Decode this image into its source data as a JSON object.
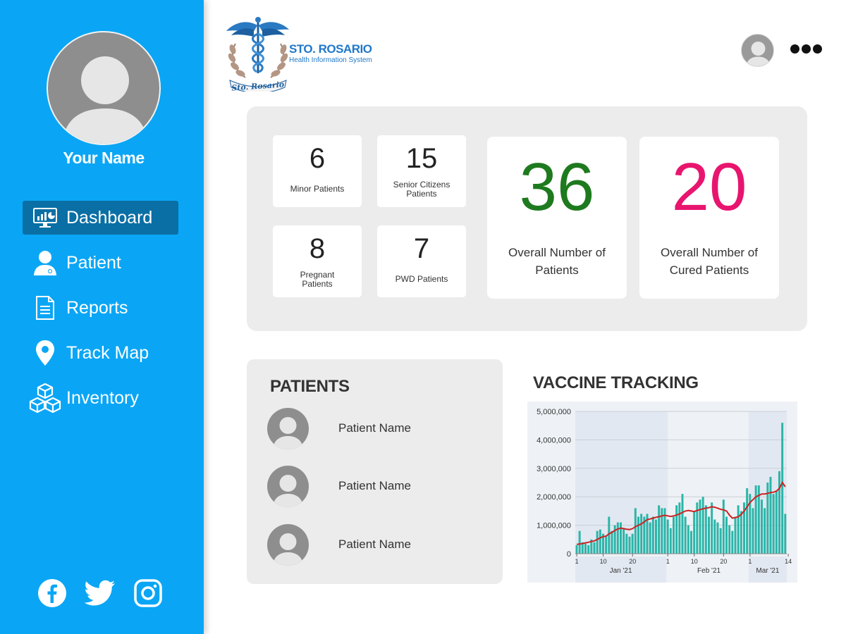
{
  "sidebar": {
    "user_name": "Your Name",
    "nav": [
      {
        "label": "Dashboard",
        "icon": "dashboard-monitor-icon",
        "active": true
      },
      {
        "label": "Patient",
        "icon": "patient-icon",
        "active": false
      },
      {
        "label": "Reports",
        "icon": "document-icon",
        "active": false
      },
      {
        "label": "Track Map",
        "icon": "map-pin-icon",
        "active": false
      },
      {
        "label": "Inventory",
        "icon": "boxes-icon",
        "active": false
      }
    ],
    "social": [
      "facebook-icon",
      "twitter-icon",
      "instagram-icon"
    ]
  },
  "header": {
    "logo_title": "STO. ROSARIO",
    "logo_subtitle": "Health Information System",
    "logo_seal_text": "Sto. Rosario"
  },
  "stats": {
    "minor": {
      "value": "6",
      "label": "Minor Patients"
    },
    "senior": {
      "value": "15",
      "label_line1": "Senior Citizens",
      "label_line2": "Patients"
    },
    "pregnant": {
      "value": "8",
      "label_line1": "Pregnant",
      "label_line2": "Patients"
    },
    "pwd": {
      "value": "7",
      "label": "PWD Patients"
    },
    "overall": {
      "value": "36",
      "label_line1": "Overall Number of",
      "label_line2": "Patients",
      "color": "#1e7a1e"
    },
    "cured": {
      "value": "20",
      "label_line1": "Overall Number of",
      "label_line2": "Cured Patients",
      "color": "#e8156f"
    }
  },
  "patients": {
    "title": "PATIENTS",
    "items": [
      {
        "name": "Patient Name"
      },
      {
        "name": "Patient Name"
      },
      {
        "name": "Patient Name"
      }
    ]
  },
  "vaccine": {
    "title": "VACCINE TRACKING"
  },
  "colors": {
    "sidebar": "#0aa6f5",
    "nav_active": "#0a6fa5",
    "bar": "#2bb5a8",
    "avg_line": "#cc2222"
  },
  "chart_data": {
    "type": "bar",
    "ylim": [
      0,
      5000000
    ],
    "y_ticks": [
      "0",
      "1,000,000",
      "2,000,000",
      "3,000,000",
      "4,000,000",
      "5,000,000"
    ],
    "x_tick_labels": [
      "1",
      "10",
      "20",
      "1",
      "10",
      "20",
      "1",
      "14"
    ],
    "x_tick_days": [
      1,
      10,
      20,
      32,
      41,
      51,
      60,
      73
    ],
    "month_labels": [
      "Jan '21",
      "Feb '21",
      "Mar '21"
    ],
    "month_days": [
      16,
      46,
      66
    ],
    "series": [
      {
        "type": "bar",
        "values": [
          300000,
          800000,
          400000,
          350000,
          300000,
          500000,
          400000,
          800000,
          850000,
          700000,
          600000,
          1300000,
          800000,
          1000000,
          1100000,
          1100000,
          900000,
          700000,
          600000,
          700000,
          1600000,
          1300000,
          1400000,
          1300000,
          1400000,
          1100000,
          1300000,
          1200000,
          1700000,
          1600000,
          1600000,
          1200000,
          900000,
          1300000,
          1700000,
          1800000,
          2100000,
          1300000,
          1000000,
          800000,
          1500000,
          1800000,
          1900000,
          2000000,
          1700000,
          1300000,
          1800000,
          1200000,
          1100000,
          900000,
          1900000,
          1300000,
          1000000,
          800000,
          1300000,
          1700000,
          1500000,
          1800000,
          2300000,
          2100000,
          1600000,
          2400000,
          2400000,
          1900000,
          1600000,
          2500000,
          2700000,
          2100000,
          2200000,
          2900000,
          4600000,
          1400000
        ]
      },
      {
        "type": "line",
        "name": "average",
        "values": [
          330000,
          340000,
          360000,
          380000,
          400000,
          430000,
          450000,
          500000,
          560000,
          600000,
          620000,
          700000,
          750000,
          820000,
          870000,
          900000,
          880000,
          860000,
          850000,
          880000,
          950000,
          1000000,
          1050000,
          1120000,
          1200000,
          1220000,
          1250000,
          1280000,
          1300000,
          1330000,
          1350000,
          1330000,
          1310000,
          1330000,
          1360000,
          1400000,
          1450000,
          1500000,
          1520000,
          1500000,
          1480000,
          1520000,
          1550000,
          1580000,
          1600000,
          1620000,
          1650000,
          1630000,
          1600000,
          1560000,
          1540000,
          1500000,
          1350000,
          1250000,
          1270000,
          1300000,
          1380000,
          1500000,
          1650000,
          1800000,
          1900000,
          2000000,
          2050000,
          2100000,
          2100000,
          2120000,
          2150000,
          2160000,
          2200000,
          2300000,
          2500000,
          2350000
        ]
      }
    ]
  }
}
